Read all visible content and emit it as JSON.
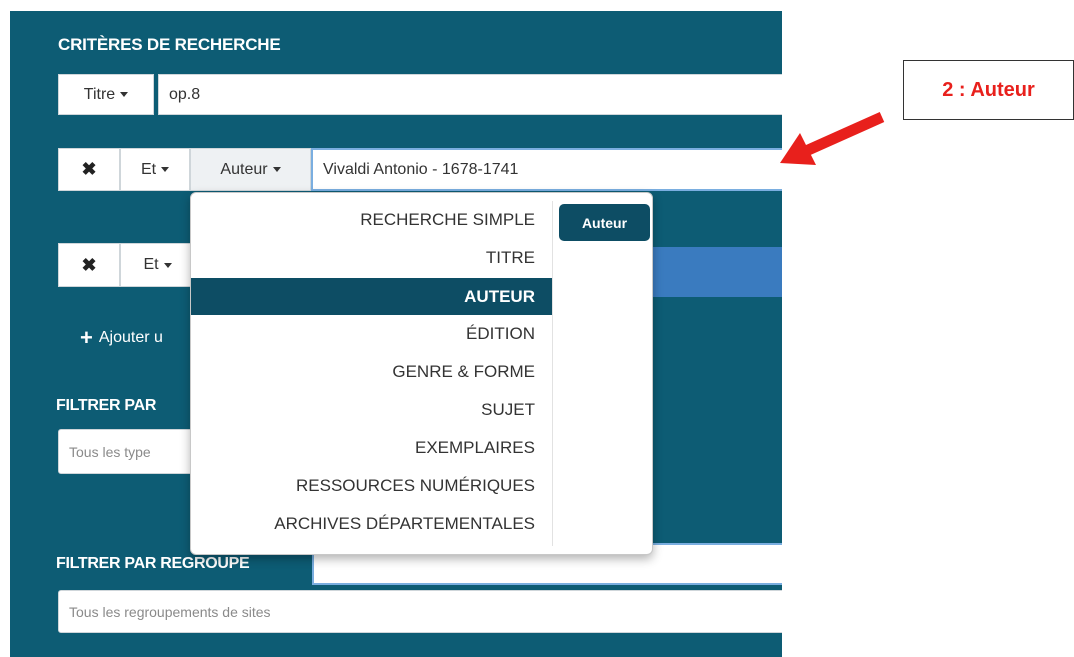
{
  "panel": {
    "title": "CRITÈRES DE RECHERCHE",
    "row1": {
      "field_label": "Titre",
      "value": "op.8"
    },
    "row2": {
      "operator": "Et",
      "field_label": "Auteur",
      "value": "Vivaldi Antonio - 1678-1741"
    },
    "row3": {
      "operator": "Et"
    },
    "add_label": "Ajouter u",
    "filter_type_label": "FILTRER PAR",
    "filter_type_placeholder": "Tous les type",
    "filter_group_label": "FILTRER PAR REGROUPE",
    "filter_group_placeholder": "Tous les regroupements de sites"
  },
  "menu": {
    "items": [
      "RECHERCHE SIMPLE",
      "TITRE",
      "AUTEUR",
      "ÉDITION",
      "GENRE & FORME",
      "SUJET",
      "EXEMPLAIRES",
      "RESSOURCES NUMÉRIQUES",
      "ARCHIVES DÉPARTEMENTALES"
    ],
    "active": "AUTEUR",
    "tag": "Auteur"
  },
  "callout": {
    "text": "2 : Auteur"
  },
  "colors": {
    "panel": "#0d5c74",
    "menu_active": "#0d4d64",
    "accent": "#e8201c",
    "blue_bar": "#3a7bbf"
  },
  "icons": {
    "remove": "close-icon",
    "caret": "caret-down-icon",
    "add": "plus-icon",
    "pointer": "red-arrow-icon"
  }
}
